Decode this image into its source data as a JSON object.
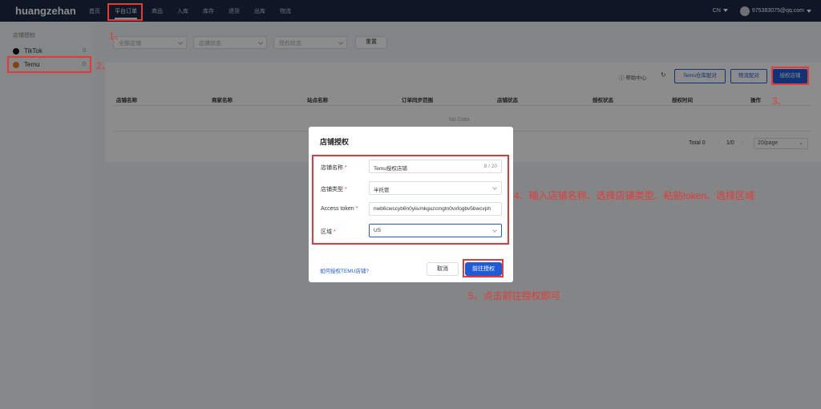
{
  "nav": {
    "brand": "huangzehan",
    "items": [
      "首页",
      "平台订单",
      "商品",
      "入库",
      "库存",
      "退货",
      "出库",
      "物流"
    ],
    "lang": "CN",
    "user": "975383075@qq.com"
  },
  "sidebar": {
    "title": "店铺授权",
    "items": [
      {
        "label": "TikTok",
        "count": "0"
      },
      {
        "label": "Temu",
        "count": "0"
      }
    ]
  },
  "filters": {
    "all_shops": "全部店铺",
    "shop_status": "店铺状态",
    "auth_status": "授权状态",
    "reset": "重置"
  },
  "toolbar": {
    "help": "帮助中心",
    "temu_warehouse": "Temu仓库配对",
    "logistics": "物流配对",
    "authorize": "授权店铺"
  },
  "table": {
    "headers": [
      "店铺名称",
      "商家名称",
      "站点名称",
      "订单同步范围",
      "店铺状态",
      "授权状态",
      "授权时间",
      "操作"
    ],
    "empty": "No Data"
  },
  "pager": {
    "total": "Total 0",
    "page": "1/0",
    "size": "20/page"
  },
  "modal": {
    "title": "店铺授权",
    "shop_name_label": "店铺名称",
    "shop_name_value": "Temu授权店铺",
    "shop_name_count": "8 / 20",
    "shop_type_label": "店铺类型",
    "shop_type_value": "半托管",
    "token_label": "Access token",
    "token_value": "nwb6cwccyb6n0yiiumkguzcmgtn0vxfogbv5bwcvph",
    "region_label": "区域",
    "region_value": "US",
    "help_link": "如何授权TEMU店铺?",
    "cancel": "取消",
    "confirm": "前往授权"
  },
  "annotations": {
    "a1": "1、",
    "a2": "2、",
    "a3": "3、",
    "a4": "4、输入店铺名称、选择店铺类型、粘贴token、选择区域",
    "a5": "5、点击前往授权即可"
  }
}
